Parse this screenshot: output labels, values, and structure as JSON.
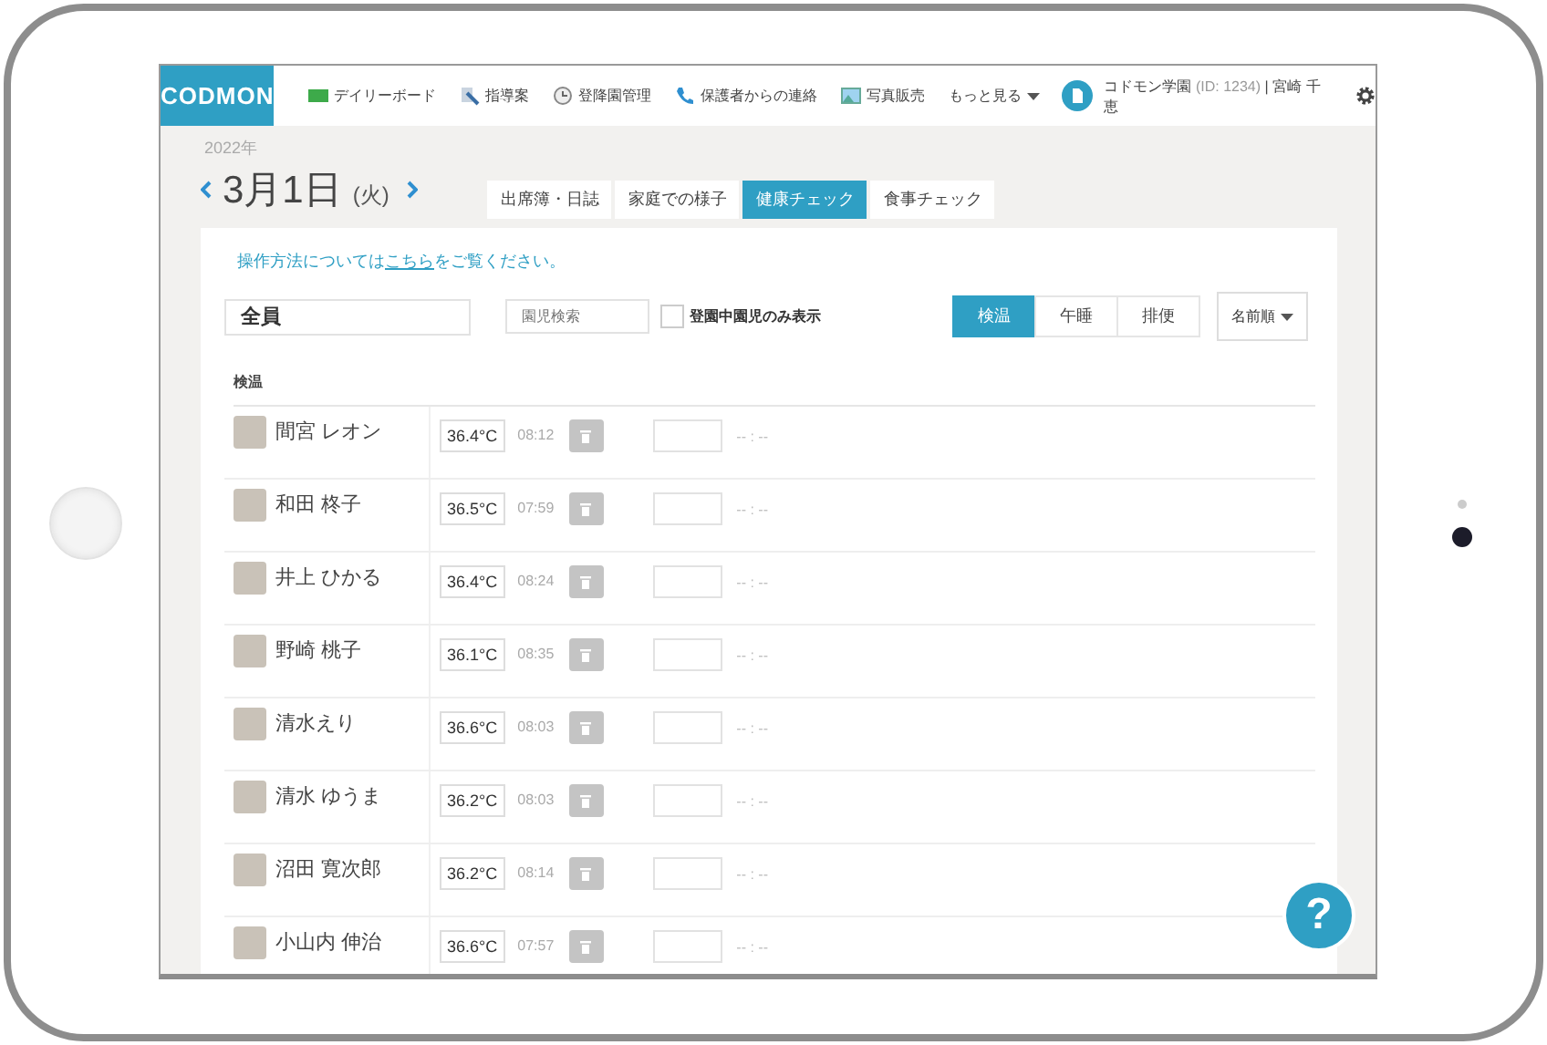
{
  "header": {
    "logo": "CODMON",
    "nav": [
      {
        "label": "デイリーボード",
        "kind": "board"
      },
      {
        "label": "指導案",
        "kind": "pencil"
      },
      {
        "label": "登降園管理",
        "kind": "clock"
      },
      {
        "label": "保護者からの連絡",
        "kind": "phone"
      },
      {
        "label": "写真販売",
        "kind": "photo"
      },
      {
        "label": "もっと見る",
        "kind": "more"
      }
    ],
    "account": {
      "name": "コドモン学園",
      "id": "(ID: 1234)",
      "user": "| 宮崎 千恵"
    }
  },
  "date": {
    "year": "2022年",
    "day": "3月1日",
    "weekday": "(火)"
  },
  "tabs": [
    {
      "label": "出席簿・日誌",
      "selected": false
    },
    {
      "label": "家庭での様子",
      "selected": false
    },
    {
      "label": "健康チェック",
      "selected": true
    },
    {
      "label": "食事チェック",
      "selected": false
    }
  ],
  "help": {
    "before": "操作方法については",
    "link": "こちら",
    "after": "をご覧ください。"
  },
  "filters": {
    "group": "全員",
    "search_placeholder": "園児検索",
    "present_only": {
      "label": "登園中園児のみ表示",
      "checked": false
    },
    "modes": [
      {
        "label": "検温",
        "selected": true
      },
      {
        "label": "午睡",
        "selected": false
      },
      {
        "label": "排便",
        "selected": false
      }
    ],
    "sort": "名前順"
  },
  "section": "検温",
  "rows": [
    {
      "name": "間宮 レオン",
      "temp": "36.4°C",
      "time": "08:12",
      "time2": "-- : --"
    },
    {
      "name": "和田 柊子",
      "temp": "36.5°C",
      "time": "07:59",
      "time2": "-- : --"
    },
    {
      "name": "井上 ひかる",
      "temp": "36.4°C",
      "time": "08:24",
      "time2": "-- : --"
    },
    {
      "name": "野崎 桃子",
      "temp": "36.1°C",
      "time": "08:35",
      "time2": "-- : --"
    },
    {
      "name": "清水えり",
      "temp": "36.6°C",
      "time": "08:03",
      "time2": "-- : --"
    },
    {
      "name": "清水 ゆうま",
      "temp": "36.2°C",
      "time": "08:03",
      "time2": "-- : --"
    },
    {
      "name": "沼田 寛次郎",
      "temp": "36.2°C",
      "time": "08:14",
      "time2": "-- : --"
    },
    {
      "name": "小山内 伸治",
      "temp": "36.6°C",
      "time": "07:57",
      "time2": "-- : --"
    }
  ],
  "help_button": "?"
}
